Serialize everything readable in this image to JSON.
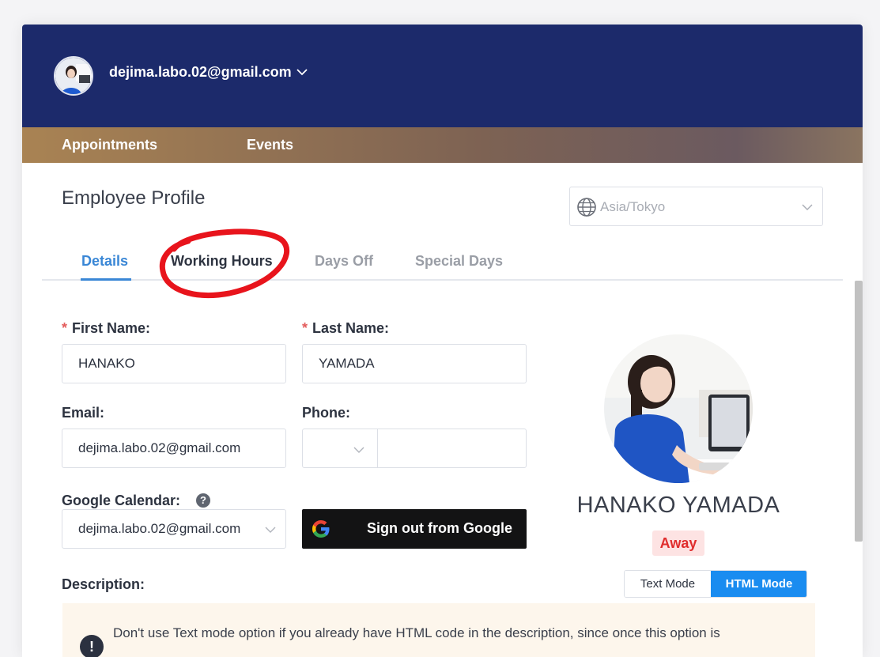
{
  "user": {
    "email": "dejima.labo.02@gmail.com"
  },
  "nav": {
    "items": [
      "Appointments",
      "Events"
    ]
  },
  "page": {
    "title": "Employee Profile"
  },
  "timezone": {
    "placeholder": "Asia/Tokyo"
  },
  "tabs": [
    {
      "label": "Details",
      "active": true
    },
    {
      "label": "Working Hours",
      "active": false
    },
    {
      "label": "Days Off",
      "active": false
    },
    {
      "label": "Special Days",
      "active": false
    }
  ],
  "form": {
    "first_name": {
      "label": "First Name:",
      "value": "HANAKO",
      "required_mark": "*"
    },
    "last_name": {
      "label": "Last Name:",
      "value": "YAMADA",
      "required_mark": "*"
    },
    "email": {
      "label": "Email:",
      "value": "dejima.labo.02@gmail.com"
    },
    "phone": {
      "label": "Phone:",
      "value": ""
    },
    "google_calendar": {
      "label": "Google Calendar:",
      "value": "dejima.labo.02@gmail.com",
      "help": "?"
    },
    "google_signout": "Sign out from Google",
    "description": {
      "label": "Description:"
    }
  },
  "profile": {
    "name": "HANAKO YAMADA",
    "status": "Away"
  },
  "modes": {
    "text": "Text Mode",
    "html": "HTML Mode",
    "selected": "HTML Mode"
  },
  "notice": {
    "icon": "!",
    "text": "Don't use Text mode option if you already have HTML code in the description, since once this option is"
  },
  "colors": {
    "header": "#1c2a6b",
    "accent": "#3a87d6",
    "primary_button": "#1a8cf0",
    "status_away": "#e02d2d",
    "annotation": "#e8141c"
  },
  "icons": [
    "avatar",
    "chevron-down-icon",
    "globe-icon",
    "help-icon",
    "google-g-icon",
    "exclamation-icon"
  ]
}
